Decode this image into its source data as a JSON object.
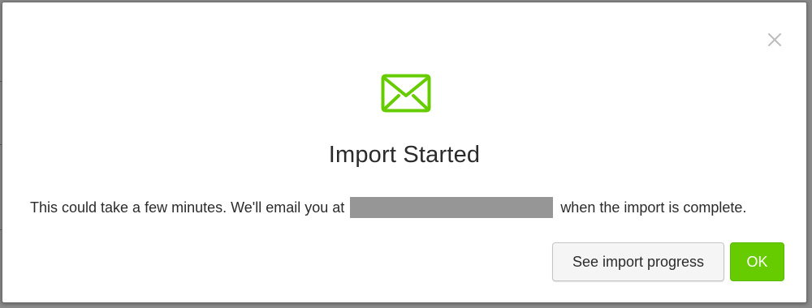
{
  "modal": {
    "title": "Import Started",
    "message_before": "This could take a few minutes. We'll email you at",
    "message_after": "when the import is complete.",
    "email_redacted": "",
    "icon": "envelope-icon",
    "close_icon": "close-icon",
    "buttons": {
      "see_progress_label": "See import progress",
      "ok_label": "OK"
    }
  },
  "colors": {
    "accent_green": "#66cc00",
    "redaction_gray": "#969696",
    "text": "#2b2b2b",
    "close_icon": "#bdbdbd"
  }
}
